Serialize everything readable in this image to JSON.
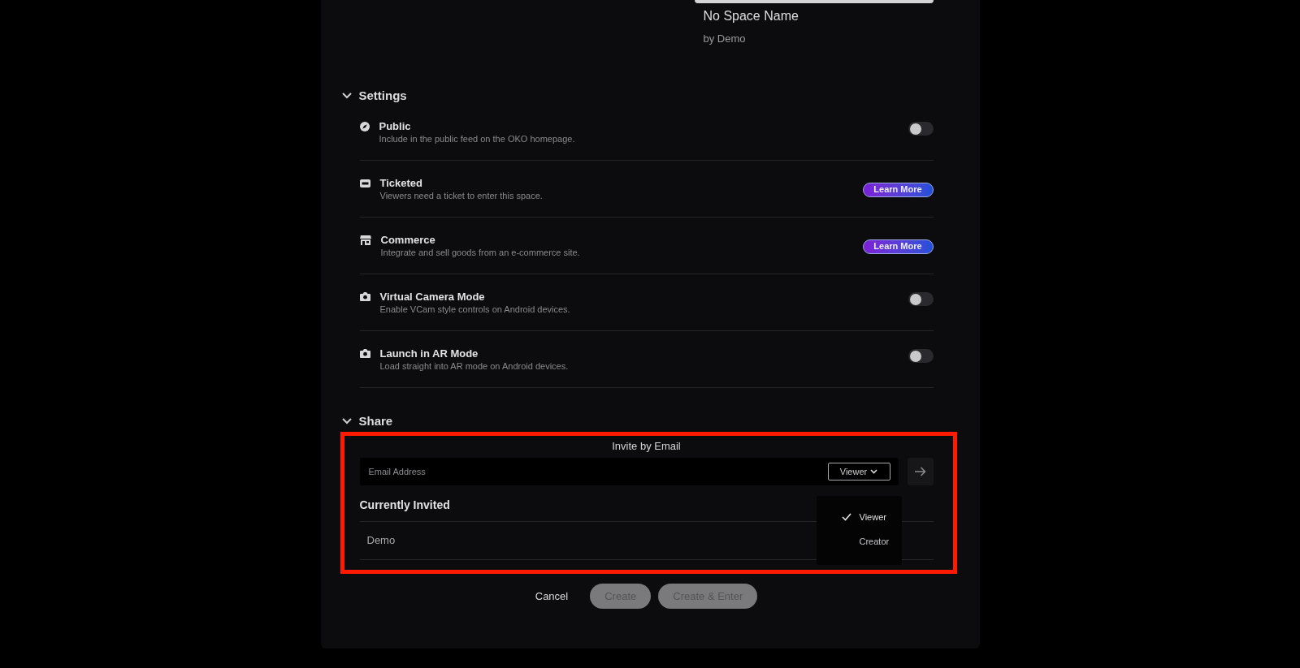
{
  "space_card": {
    "title": "No Space Name",
    "author": "by Demo"
  },
  "settings": {
    "title": "Settings",
    "expanded": true,
    "items": [
      {
        "kind": "toggle",
        "title": "Public",
        "description": "Include in the public feed on the OKO homepage.",
        "on": false
      },
      {
        "kind": "link",
        "title": "Ticketed",
        "description": "Viewers need a ticket to enter this space.",
        "button": "Learn More"
      },
      {
        "kind": "link",
        "title": "Commerce",
        "description": "Integrate and sell goods from an e-commerce site.",
        "button": "Learn More"
      },
      {
        "kind": "toggle",
        "title": "Virtual Camera Mode",
        "description": "Enable VCam style controls on Android devices.",
        "on": false
      },
      {
        "kind": "toggle",
        "title": "Launch in AR Mode",
        "description": "Load straight into AR mode on Android devices.",
        "on": false
      }
    ]
  },
  "share": {
    "title": "Share",
    "expanded": true,
    "highlighted": true,
    "invite_title": "Invite by Email",
    "email_field": {
      "placeholder": "Email Address"
    },
    "role_select": {
      "value": "Viewer",
      "expanded": true,
      "options": [
        {
          "label": "Viewer",
          "selected": true
        },
        {
          "label": "Creator",
          "selected": false
        }
      ]
    },
    "invited_title": "Currently Invited",
    "invited": [
      {
        "name": "Demo"
      }
    ]
  },
  "buttons": [
    {
      "kind": "text",
      "label": "Cancel",
      "disabled": false
    },
    {
      "kind": "pill",
      "label": "Create",
      "disabled": true
    },
    {
      "kind": "pill",
      "label": "Create & Enter",
      "disabled": true
    }
  ]
}
